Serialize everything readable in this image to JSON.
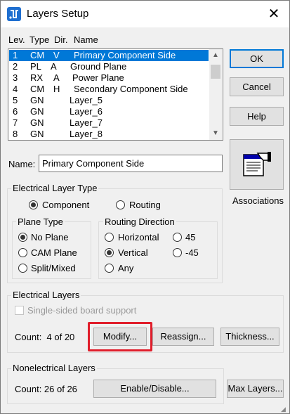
{
  "window": {
    "title": "Layers Setup",
    "close_symbol": "✕"
  },
  "columns": {
    "lev": "Lev.",
    "type": "Type",
    "dir": "Dir.",
    "name": "Name"
  },
  "layers": [
    {
      "lev": "1",
      "type": "CM",
      "dir": "V",
      "name": "Primary Component Side"
    },
    {
      "lev": "2",
      "type": "PL",
      "dir": "A",
      "name": "Ground Plane"
    },
    {
      "lev": "3",
      "type": "RX",
      "dir": "A",
      "name": "Power Plane"
    },
    {
      "lev": "4",
      "type": "CM",
      "dir": "H",
      "name": "Secondary Component Side"
    },
    {
      "lev": "5",
      "type": "GN",
      "dir": "",
      "name": "Layer_5"
    },
    {
      "lev": "6",
      "type": "GN",
      "dir": "",
      "name": "Layer_6"
    },
    {
      "lev": "7",
      "type": "GN",
      "dir": "",
      "name": "Layer_7"
    },
    {
      "lev": "8",
      "type": "GN",
      "dir": "",
      "name": "Layer_8"
    }
  ],
  "buttons": {
    "ok": "OK",
    "cancel": "Cancel",
    "help": "Help",
    "associations": "Associations",
    "modify": "Modify...",
    "reassign": "Reassign...",
    "thickness": "Thickness...",
    "enable_disable": "Enable/Disable...",
    "max_layers": "Max Layers..."
  },
  "name_field": {
    "label": "Name:",
    "value": "Primary Component Side"
  },
  "electrical_layer_type": {
    "title": "Electrical  Layer Type",
    "component": "Component",
    "routing": "Routing",
    "selected": "Component"
  },
  "plane_type": {
    "title": "Plane Type",
    "options": [
      "No Plane",
      "CAM Plane",
      "Split/Mixed"
    ],
    "selected": "No Plane"
  },
  "routing_direction": {
    "title": "Routing Direction",
    "horizontal": "Horizontal",
    "vertical": "Vertical",
    "any": "Any",
    "d45": "45",
    "dm45": "-45",
    "selected": "Vertical"
  },
  "electrical_layers": {
    "title": "Electrical Layers",
    "single_sided": "Single-sided board support",
    "count": "Count:  4 of 20"
  },
  "nonelectrical_layers": {
    "title": "Nonelectrical Layers",
    "count": "Count: 26 of 26"
  },
  "colors": {
    "selection": "#0078d7",
    "highlight": "#e01e2b",
    "default_button_border": "#0078d7"
  }
}
